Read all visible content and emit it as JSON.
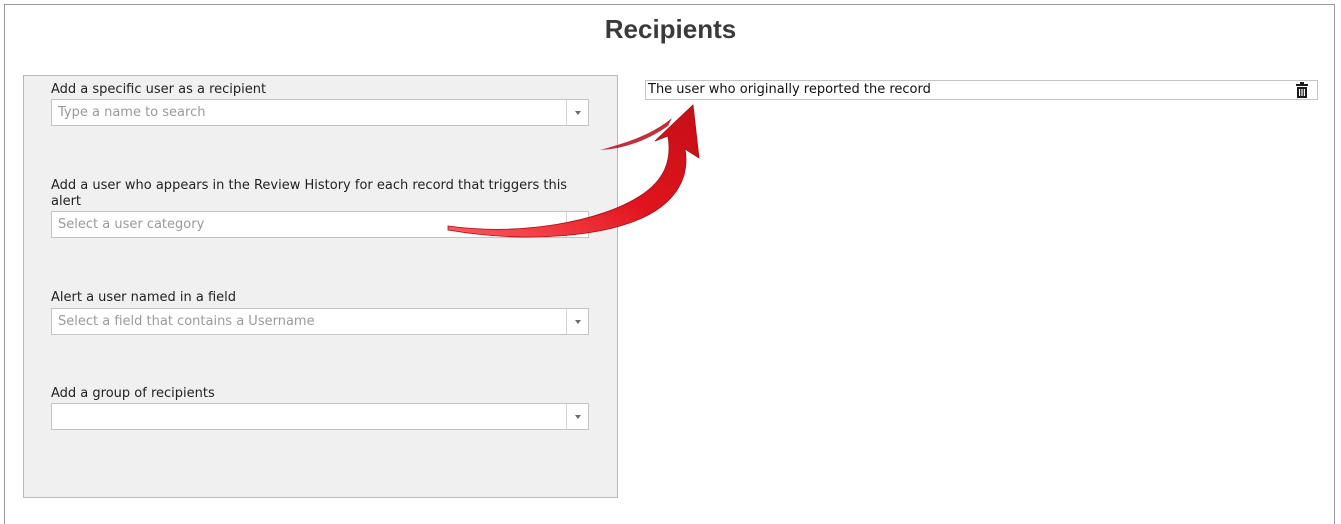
{
  "page": {
    "title": "Recipients"
  },
  "fields": [
    {
      "label": "Add a specific user as a recipient",
      "placeholder": "Type a name to search"
    },
    {
      "label": "Add a user who appears in the Review History for each record that triggers this alert",
      "placeholder": "Select a user category"
    },
    {
      "label": "Alert a user named in a field",
      "placeholder": "Select a field that contains a Username"
    },
    {
      "label": "Add a group of recipients",
      "placeholder": ""
    }
  ],
  "recipients": [
    {
      "text": "The user who originally reported the record",
      "action_icon": "trash-icon"
    }
  ],
  "colors": {
    "annotation_arrow": "#d8121b",
    "panel_background": "#f0f0f0",
    "placeholder_text": "#9a9a9a"
  },
  "icons": {
    "dropdown": "chevron-down-icon",
    "delete": "trash-icon",
    "annotation": "curved-arrow-icon"
  }
}
